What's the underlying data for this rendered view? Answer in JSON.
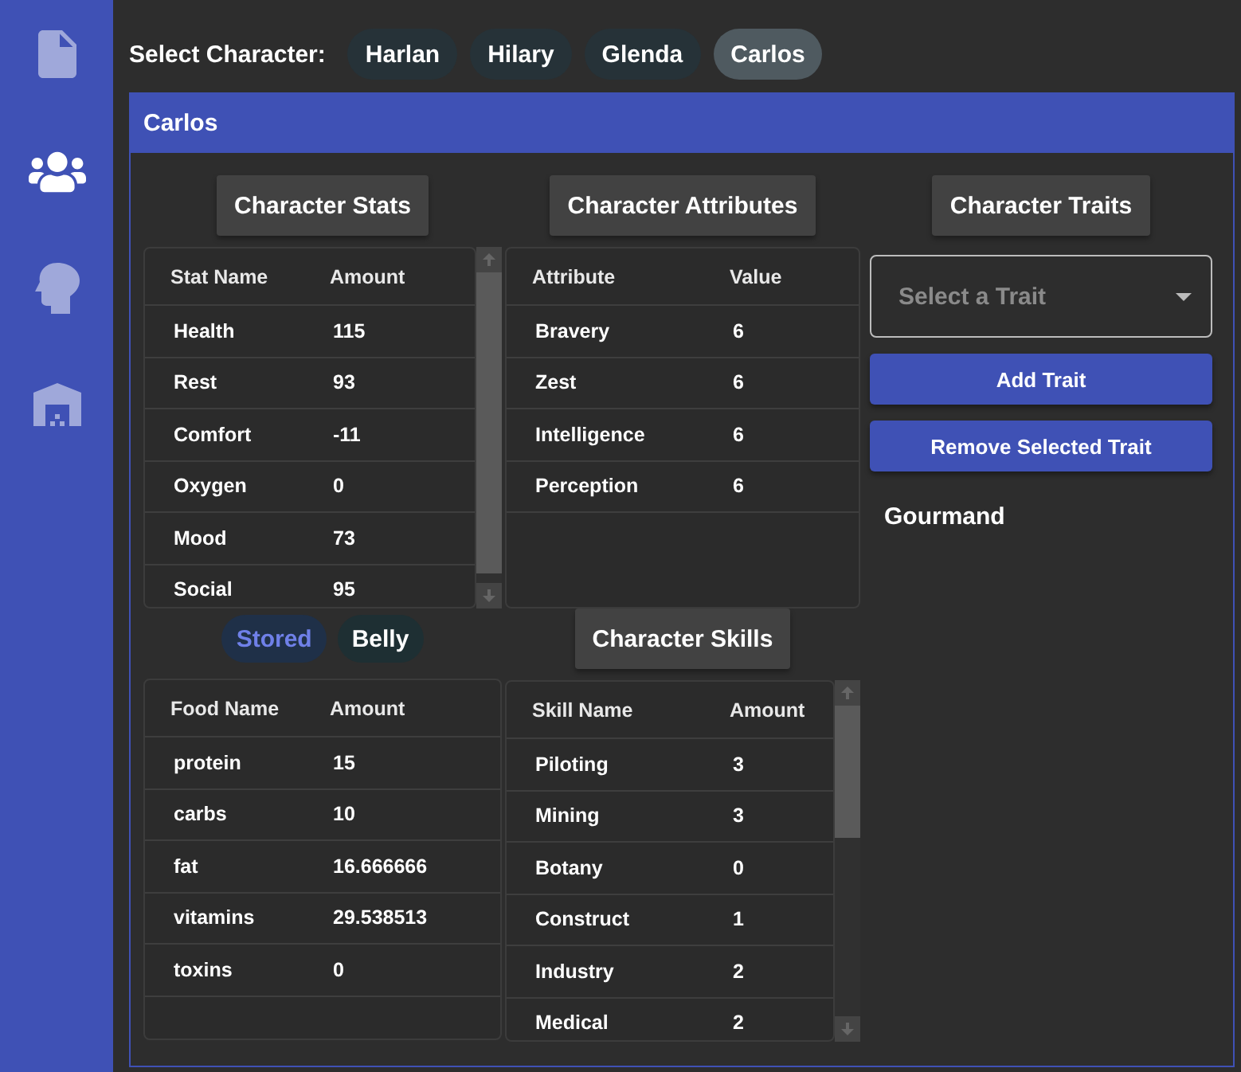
{
  "sidebar": {
    "items": [
      {
        "kind": "document",
        "selected": false
      },
      {
        "kind": "people",
        "selected": true
      },
      {
        "kind": "head",
        "selected": false
      },
      {
        "kind": "warehouse",
        "selected": false
      }
    ]
  },
  "character_picker": {
    "label": "Select Character:",
    "options": [
      {
        "label": "Harlan",
        "selected": false
      },
      {
        "label": "Hilary",
        "selected": false
      },
      {
        "label": "Glenda",
        "selected": false
      },
      {
        "label": "Carlos",
        "selected": true
      }
    ]
  },
  "panel": {
    "title": "Carlos",
    "stats": {
      "heading": "Character Stats",
      "columns": [
        "Stat Name",
        "Amount"
      ],
      "rows": [
        [
          "Health",
          "115"
        ],
        [
          "Rest",
          "93"
        ],
        [
          "Comfort",
          "-11"
        ],
        [
          "Oxygen",
          "0"
        ],
        [
          "Mood",
          "73"
        ],
        [
          "Social",
          "95"
        ]
      ]
    },
    "attributes": {
      "heading": "Character Attributes",
      "columns": [
        "Attribute",
        "Value"
      ],
      "rows": [
        [
          "Bravery",
          "6"
        ],
        [
          "Zest",
          "6"
        ],
        [
          "Intelligence",
          "6"
        ],
        [
          "Perception",
          "6"
        ]
      ]
    },
    "traits": {
      "heading": "Character Traits",
      "select": {
        "placeholder": "Select a Trait"
      },
      "buttons": [
        "Add Trait",
        "Remove Selected Trait"
      ],
      "items": [
        "Gourmand"
      ]
    },
    "food": {
      "toggle": [
        {
          "label": "Stored",
          "selected": true
        },
        {
          "label": "Belly",
          "selected": false
        }
      ],
      "columns": [
        "Food Name",
        "Amount"
      ],
      "rows": [
        [
          "protein",
          "15"
        ],
        [
          "carbs",
          "10"
        ],
        [
          "fat",
          "16.666666"
        ],
        [
          "vitamins",
          "29.538513"
        ],
        [
          "toxins",
          "0"
        ]
      ]
    },
    "skills": {
      "heading": "Character Skills",
      "columns": [
        "Skill Name",
        "Amount"
      ],
      "rows": [
        [
          "Piloting",
          "3"
        ],
        [
          "Mining",
          "3"
        ],
        [
          "Botany",
          "0"
        ],
        [
          "Construct",
          "1"
        ],
        [
          "Industry",
          "2"
        ],
        [
          "Medical",
          "2"
        ]
      ]
    }
  }
}
